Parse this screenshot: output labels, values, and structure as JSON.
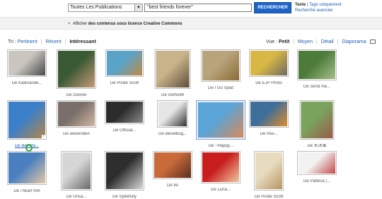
{
  "search": {
    "scope": "Toutes Les Publications",
    "query": "\"best friends forever\"",
    "button": "RECHERCHER",
    "mode_label": "Texte",
    "mode_tags": "Tags uniquement",
    "advanced": "Recherche avancée"
  },
  "cc": {
    "plus": "+",
    "afficher": "Afficher",
    "rest": "des contenus sous licence Creative Commons"
  },
  "sort": {
    "label": "Tri :",
    "options": [
      "Pertinent",
      "Récent",
      "Intéressant"
    ]
  },
  "view": {
    "label": "Vue :",
    "options": [
      "Petit",
      "Moyen",
      "Détail",
      "Diaporama"
    ]
  },
  "photos": [
    {
      "caption": "De Kalexande...",
      "colors": [
        "#c9c6bf",
        "#4a4a4a"
      ]
    },
    {
      "caption": "De zubrow",
      "colors": [
        "#3a5a34",
        "#c89a7a"
      ]
    },
    {
      "caption": "De Pirate Scott",
      "colors": [
        "#5aa3c8",
        "#c08a45"
      ]
    },
    {
      "caption": "De clotho98",
      "colors": [
        "#c9b38a",
        "#5e4e3a"
      ]
    },
    {
      "caption": "De I Go Splat",
      "colors": [
        "#b8a47a",
        "#8b6a36"
      ]
    },
    {
      "caption": "De EJP Photo",
      "colors": [
        "#d8b844",
        "#6e6a62"
      ]
    },
    {
      "caption": "De Send me...",
      "colors": [
        "#4c7b3a",
        "#a8c08a"
      ]
    },
    {
      "caption": "De Beverly...",
      "colors": [
        "#3c7fc9",
        "#b68649"
      ]
    },
    {
      "caption": "De wickenden",
      "colors": [
        "#7a6f6a",
        "#d1b8a2"
      ]
    },
    {
      "caption": "De Official...",
      "colors": [
        "#2c2c2c",
        "#8a8a8a"
      ]
    },
    {
      "caption": "De dieselbug...",
      "colors": [
        "#e6e6e6",
        "#333333"
      ]
    },
    {
      "caption": "De ~Happy...",
      "colors": [
        "#5aa4d8",
        "#d98a5a"
      ]
    },
    {
      "caption": "De Rev...",
      "colors": [
        "#3e6e9a",
        "#e08c2c"
      ]
    },
    {
      "caption": "De 水冰果",
      "colors": [
        "#7aa35e",
        "#9a5a4a"
      ]
    },
    {
      "caption": "De i heart him",
      "colors": [
        "#4a7fc0",
        "#e6c9a3"
      ]
    },
    {
      "caption": "De Urica...",
      "colors": [
        "#d6d6d6",
        "#6a6a6a"
      ]
    },
    {
      "caption": "De Spitefully",
      "colors": [
        "#2e2e2e",
        "#d8d8d8"
      ]
    },
    {
      "caption": "De 8o",
      "colors": [
        "#c86a3a",
        "#5a2e1e"
      ]
    },
    {
      "caption": "De Luna...",
      "colors": [
        "#c81e1e",
        "#f0c8a0"
      ]
    },
    {
      "caption": "De Pirate Scott",
      "colors": [
        "#e8dcc0",
        "#b89464"
      ]
    },
    {
      "caption": "De Patteca |...",
      "colors": [
        "#f2f2f2",
        "#c44a4a"
      ]
    }
  ],
  "badge": "i"
}
